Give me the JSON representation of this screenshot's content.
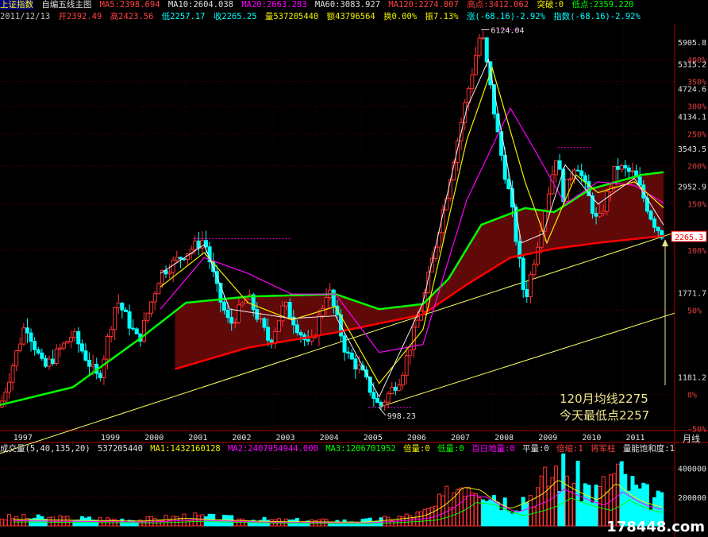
{
  "header": {
    "index_name": "上证指数",
    "template_name": "自编五线主图",
    "ma5": "MA5:2398.694",
    "ma10": "MA10:2604.038",
    "ma20": "MA20:2663.283",
    "ma60": "MA60:3083.927",
    "ma120": "MA120:2274.807",
    "high_point": "高点:3412.062",
    "breakout": "突破:0",
    "low_point": "低点:2359.220",
    "date": "2011/12/13",
    "open": "开2392.49",
    "high": "高2423.56",
    "low": "低2257.17",
    "close": "收2265.25",
    "volume": "量537205440",
    "amount": "额43796564",
    "turnover": "换0.00%",
    "amplitude": "振7.13%",
    "change": "涨(-68.16)-2.92%",
    "index_change": "指数(-68.16)-2.92%"
  },
  "colors": {
    "ma5": "#f0f0f0",
    "ma10": "#f0f000",
    "ma20": "#ff00ff",
    "ma60": "#00ff00",
    "ma120": "#ff0000",
    "up": "#ff3232",
    "down": "#00ffff",
    "annotation": "#f0e68c"
  },
  "annotations": {
    "peak_label": "6124.04",
    "trough_label": "998.23",
    "current_price": "2265.3",
    "note_line1": "120月均线2275",
    "note_line2": "今天最低点2257"
  },
  "period_label": "月线",
  "volume_header": {
    "title": "成交量(5,40,135,20)",
    "value": "537205440",
    "ma1": "MA1:1432160128",
    "ma2": "MA2:2407954944.000",
    "ma3": "MA3:1206701952",
    "double": "倍量:0",
    "low_vol": "低量:0",
    "hundred_low": "百日地量:0",
    "flat": "平量:0",
    "shrink": "倍缩:1",
    "general": "将军柱",
    "saturation": "量能饱和度:1"
  },
  "watermark": "178448.com",
  "chart_data": {
    "type": "candlestick",
    "period": "monthly",
    "x_ticks": [
      "1997",
      "1999",
      "2000",
      "2001",
      "2002",
      "2003",
      "2004",
      "2005",
      "2006",
      "2007",
      "2008",
      "2009",
      "2010",
      "2011"
    ],
    "y_price_ticks": [
      1181.2,
      1771.7,
      2952.9,
      3543.5,
      4134.1,
      4724.6,
      5315.2,
      5905.8
    ],
    "y_percent_ticks": [
      "-50%",
      "0%",
      "50%",
      "100%",
      "150%",
      "200%",
      "250%",
      "300%",
      "350%",
      "400%"
    ],
    "ylim": [
      900,
      6300
    ],
    "price_path": [
      {
        "x": "1996-10",
        "y": 1000
      },
      {
        "x": "1997-05",
        "y": 1500
      },
      {
        "x": "1997-10",
        "y": 1200
      },
      {
        "x": "1998-06",
        "y": 1420
      },
      {
        "x": "1999-01",
        "y": 1140
      },
      {
        "x": "1999-06",
        "y": 1680
      },
      {
        "x": "1999-12",
        "y": 1370
      },
      {
        "x": "2000-06",
        "y": 1900
      },
      {
        "x": "2000-12",
        "y": 2070
      },
      {
        "x": "2001-06",
        "y": 2240
      },
      {
        "x": "2001-10",
        "y": 1700
      },
      {
        "x": "2002-01",
        "y": 1480
      },
      {
        "x": "2002-06",
        "y": 1700
      },
      {
        "x": "2002-12",
        "y": 1360
      },
      {
        "x": "2003-04",
        "y": 1640
      },
      {
        "x": "2003-11",
        "y": 1320
      },
      {
        "x": "2004-04",
        "y": 1780
      },
      {
        "x": "2004-09",
        "y": 1290
      },
      {
        "x": "2005-01",
        "y": 1190
      },
      {
        "x": "2005-06",
        "y": 998
      },
      {
        "x": "2005-12",
        "y": 1160
      },
      {
        "x": "2006-06",
        "y": 1650
      },
      {
        "x": "2006-12",
        "y": 2680
      },
      {
        "x": "2007-05",
        "y": 4100
      },
      {
        "x": "2007-10",
        "y": 6124
      },
      {
        "x": "2008-03",
        "y": 3500
      },
      {
        "x": "2008-06",
        "y": 2700
      },
      {
        "x": "2008-10",
        "y": 1664
      },
      {
        "x": "2009-02",
        "y": 2300
      },
      {
        "x": "2009-07",
        "y": 3478
      },
      {
        "x": "2009-08",
        "y": 2700
      },
      {
        "x": "2009-12",
        "y": 3270
      },
      {
        "x": "2010-06",
        "y": 2400
      },
      {
        "x": "2010-11",
        "y": 3180
      },
      {
        "x": "2011-04",
        "y": 3050
      },
      {
        "x": "2011-09",
        "y": 2450
      },
      {
        "x": "2011-12",
        "y": 2265
      }
    ],
    "series": [
      {
        "name": "MA60",
        "points": [
          {
            "x": "1996-10",
            "y": 1010
          },
          {
            "x": "1998-06",
            "y": 1100
          },
          {
            "x": "2000-01",
            "y": 1400
          },
          {
            "x": "2001-01",
            "y": 1650
          },
          {
            "x": "2002-06",
            "y": 1700
          },
          {
            "x": "2004-06",
            "y": 1720
          },
          {
            "x": "2005-06",
            "y": 1600
          },
          {
            "x": "2006-06",
            "y": 1640
          },
          {
            "x": "2007-01",
            "y": 1850
          },
          {
            "x": "2007-10",
            "y": 2400
          },
          {
            "x": "2008-10",
            "y": 2600
          },
          {
            "x": "2009-06",
            "y": 2550
          },
          {
            "x": "2010-04",
            "y": 2850
          },
          {
            "x": "2011-06",
            "y": 3050
          },
          {
            "x": "2011-12",
            "y": 3090
          }
        ]
      },
      {
        "name": "MA120",
        "points": [
          {
            "x": "2000-10",
            "y": 1200
          },
          {
            "x": "2002-06",
            "y": 1330
          },
          {
            "x": "2004-06",
            "y": 1430
          },
          {
            "x": "2006-06",
            "y": 1560
          },
          {
            "x": "2007-06",
            "y": 1800
          },
          {
            "x": "2008-06",
            "y": 2050
          },
          {
            "x": "2009-06",
            "y": 2140
          },
          {
            "x": "2010-06",
            "y": 2200
          },
          {
            "x": "2011-12",
            "y": 2275
          }
        ]
      },
      {
        "name": "MA20",
        "points": [
          {
            "x": "2000-06",
            "y": 1600
          },
          {
            "x": "2001-06",
            "y": 2050
          },
          {
            "x": "2002-06",
            "y": 1900
          },
          {
            "x": "2003-06",
            "y": 1720
          },
          {
            "x": "2004-06",
            "y": 1720
          },
          {
            "x": "2005-06",
            "y": 1300
          },
          {
            "x": "2006-06",
            "y": 1350
          },
          {
            "x": "2007-06",
            "y": 2700
          },
          {
            "x": "2008-06",
            "y": 4200
          },
          {
            "x": "2009-01",
            "y": 3400
          },
          {
            "x": "2009-09",
            "y": 2650
          },
          {
            "x": "2010-06",
            "y": 2950
          },
          {
            "x": "2011-04",
            "y": 2900
          },
          {
            "x": "2011-12",
            "y": 2663
          }
        ]
      },
      {
        "name": "MA10",
        "points": [
          {
            "x": "2000-06",
            "y": 1780
          },
          {
            "x": "2001-06",
            "y": 2100
          },
          {
            "x": "2002-06",
            "y": 1650
          },
          {
            "x": "2003-06",
            "y": 1520
          },
          {
            "x": "2004-06",
            "y": 1620
          },
          {
            "x": "2005-06",
            "y": 1120
          },
          {
            "x": "2006-06",
            "y": 1450
          },
          {
            "x": "2007-06",
            "y": 3600
          },
          {
            "x": "2008-01",
            "y": 5100
          },
          {
            "x": "2008-10",
            "y": 2950
          },
          {
            "x": "2009-04",
            "y": 2200
          },
          {
            "x": "2009-12",
            "y": 3050
          },
          {
            "x": "2010-06",
            "y": 2800
          },
          {
            "x": "2011-04",
            "y": 2950
          },
          {
            "x": "2011-12",
            "y": 2604
          }
        ]
      },
      {
        "name": "MA5",
        "points": [
          {
            "x": "2000-06",
            "y": 1900
          },
          {
            "x": "2001-06",
            "y": 2180
          },
          {
            "x": "2002-01",
            "y": 1600
          },
          {
            "x": "2003-06",
            "y": 1530
          },
          {
            "x": "2004-06",
            "y": 1550
          },
          {
            "x": "2005-06",
            "y": 1050
          },
          {
            "x": "2006-06",
            "y": 1650
          },
          {
            "x": "2007-06",
            "y": 4200
          },
          {
            "x": "2007-12",
            "y": 5300
          },
          {
            "x": "2008-09",
            "y": 2200
          },
          {
            "x": "2009-03",
            "y": 2300
          },
          {
            "x": "2009-09",
            "y": 3200
          },
          {
            "x": "2010-06",
            "y": 2650
          },
          {
            "x": "2011-04",
            "y": 3000
          },
          {
            "x": "2011-12",
            "y": 2398
          }
        ]
      }
    ],
    "trendlines": [
      {
        "from": {
          "x": "1996-10",
          "y": 800
        },
        "to": {
          "x": "2012-03",
          "y": 2310
        }
      },
      {
        "from": {
          "x": "2005-06",
          "y": 1000
        },
        "to": {
          "x": "2012-03",
          "y": 1570
        }
      }
    ],
    "volume_ticks": [
      "200000",
      "400000"
    ],
    "volume_profile": [
      {
        "x": "1997",
        "v": 60000
      },
      {
        "x": "2000",
        "v": 45000
      },
      {
        "x": "2001",
        "v": 70000
      },
      {
        "x": "2003",
        "v": 40000
      },
      {
        "x": "2005",
        "v": 35000
      },
      {
        "x": "2006-06",
        "v": 90000
      },
      {
        "x": "2007-01",
        "v": 220000
      },
      {
        "x": "2007-05",
        "v": 360000
      },
      {
        "x": "2007-10",
        "v": 330000
      },
      {
        "x": "2008-06",
        "v": 160000
      },
      {
        "x": "2009-03",
        "v": 300000
      },
      {
        "x": "2009-07",
        "v": 430000
      },
      {
        "x": "2010-06",
        "v": 240000
      },
      {
        "x": "2010-11",
        "v": 400000
      },
      {
        "x": "2011-06",
        "v": 230000
      },
      {
        "x": "2011-12",
        "v": 170000
      }
    ]
  }
}
